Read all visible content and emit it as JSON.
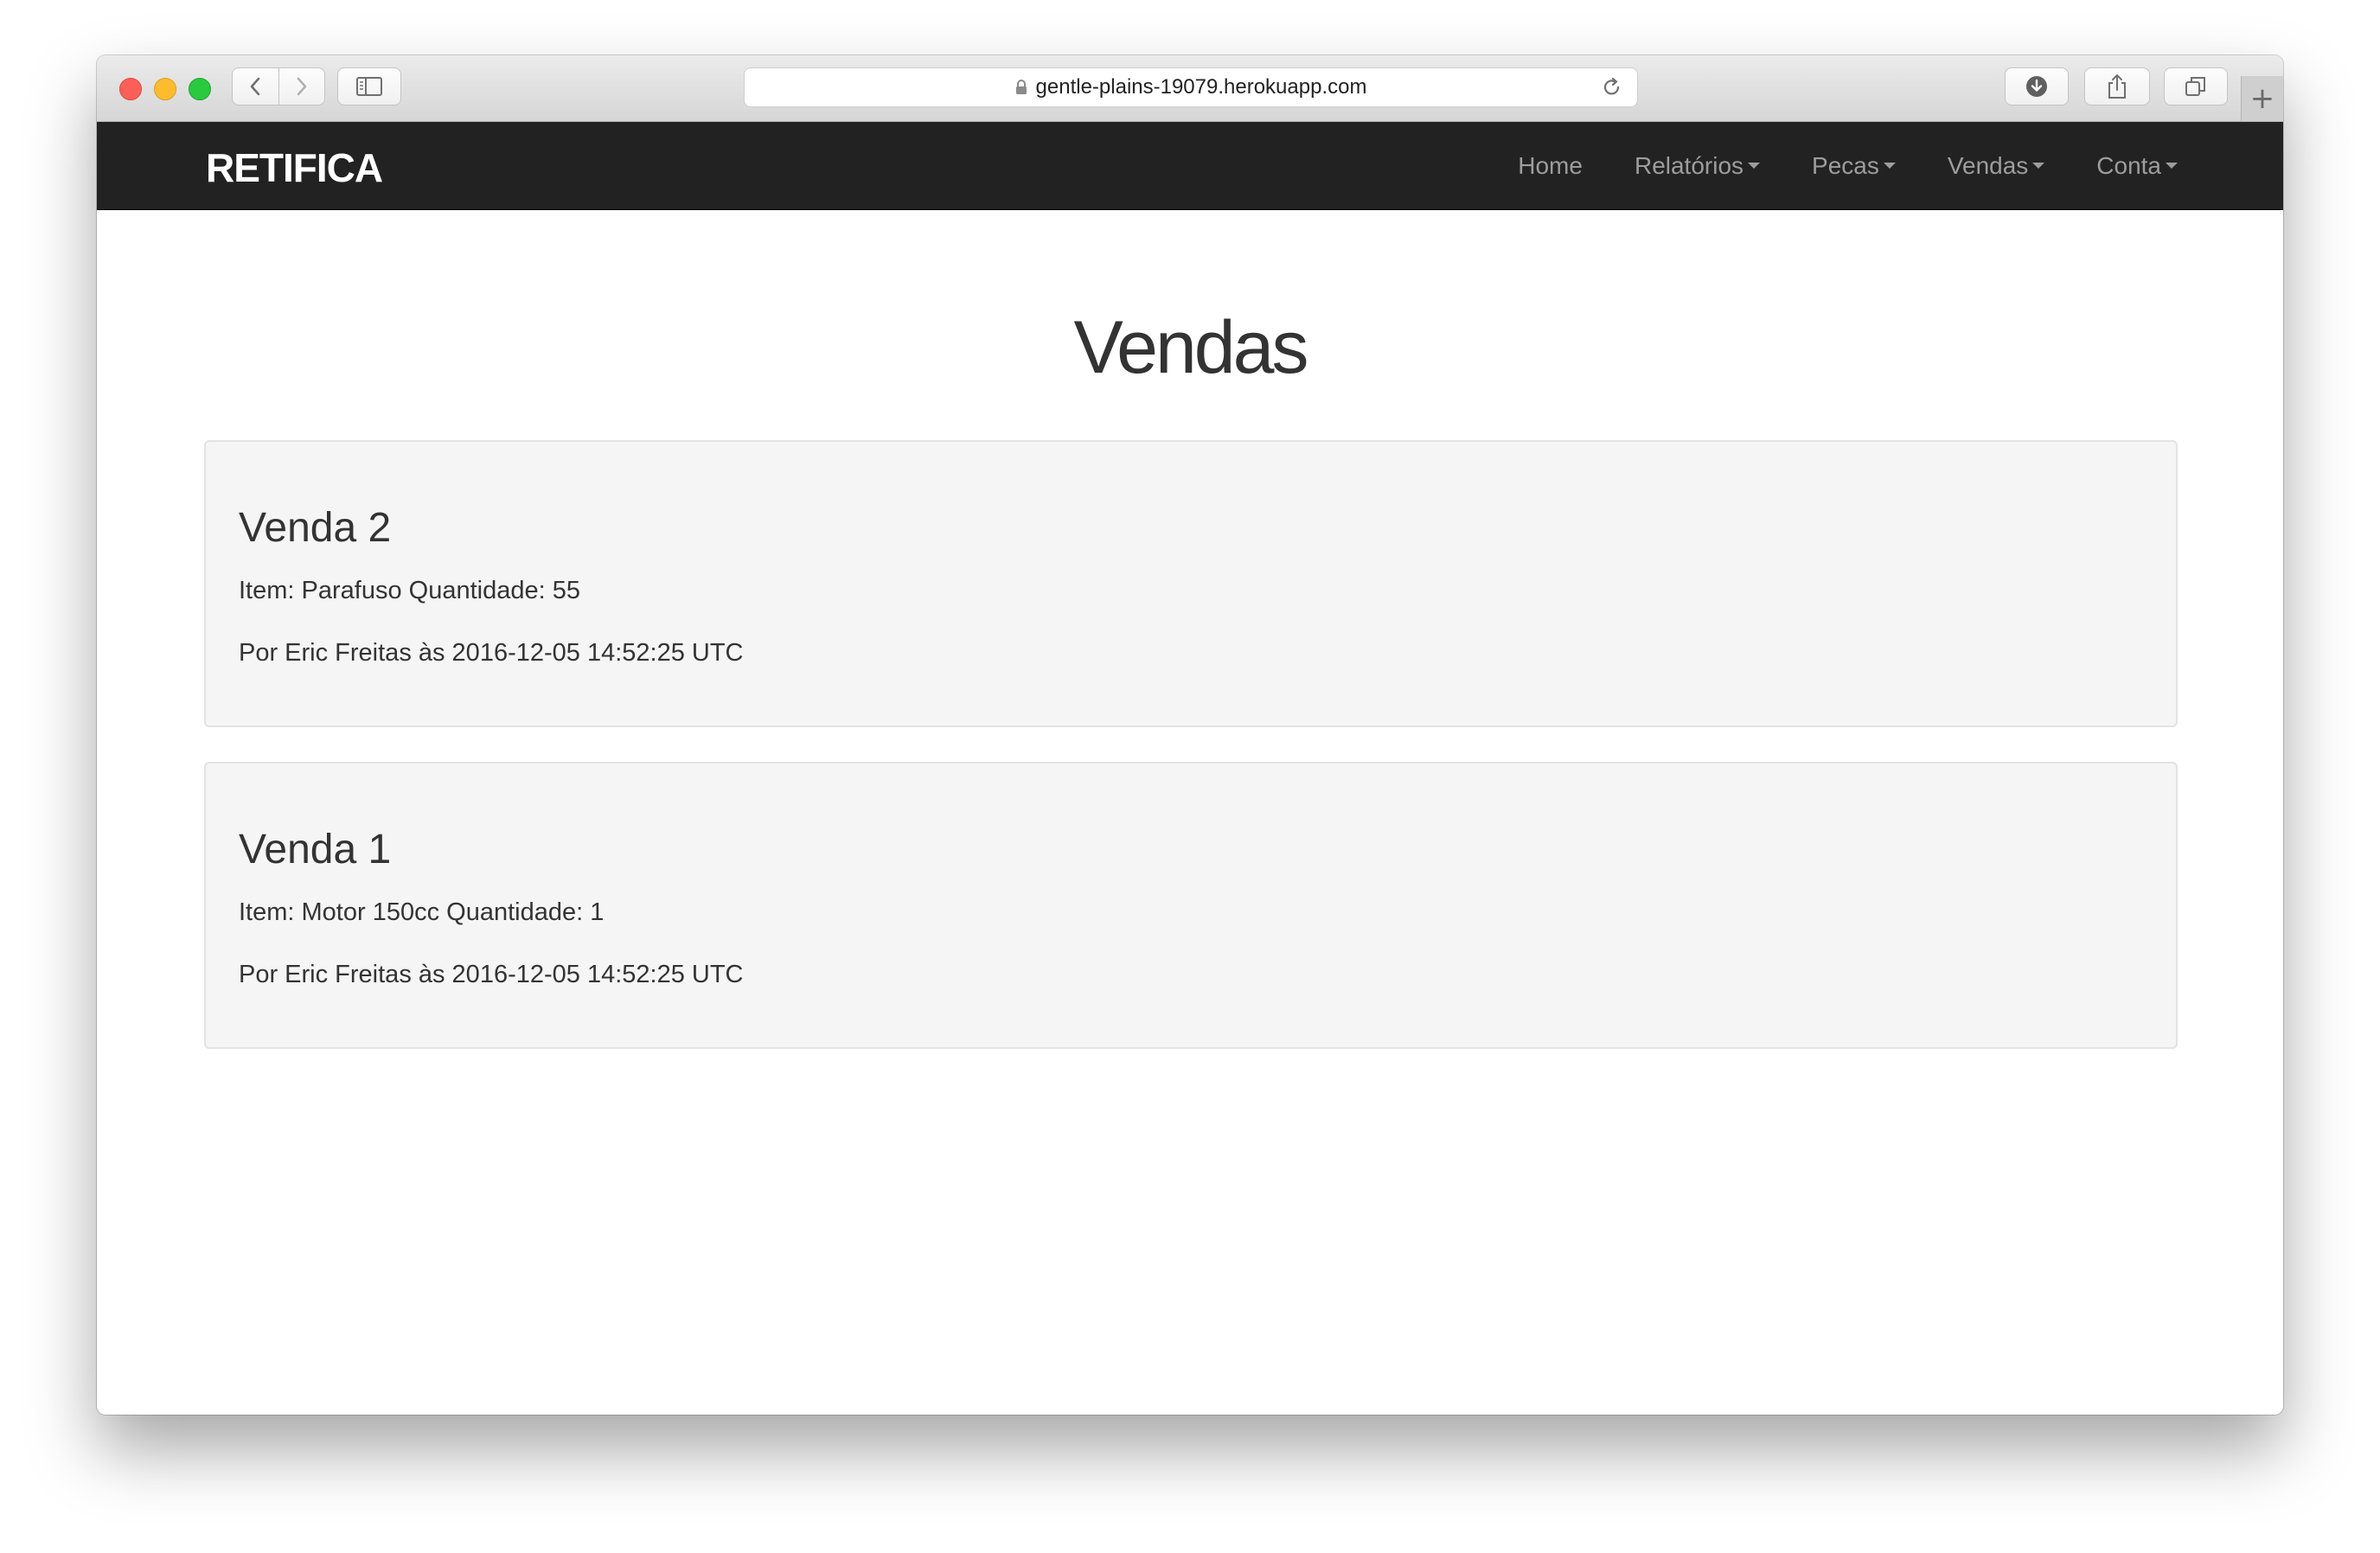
{
  "browser": {
    "url": "gentle-plains-19079.herokuapp.com",
    "new_tab_symbol": "+"
  },
  "navbar": {
    "brand": "RETIFICA",
    "items": [
      {
        "label": "Home",
        "dropdown": false
      },
      {
        "label": "Relatórios",
        "dropdown": true
      },
      {
        "label": "Pecas",
        "dropdown": true
      },
      {
        "label": "Vendas",
        "dropdown": true
      },
      {
        "label": "Conta",
        "dropdown": true
      }
    ]
  },
  "page": {
    "title": "Vendas"
  },
  "sales": [
    {
      "title": "Venda 2",
      "item_line": "Item: Parafuso Quantidade: 55",
      "by_line": "Por Eric Freitas às 2016-12-05 14:52:25 UTC"
    },
    {
      "title": "Venda 1",
      "item_line": "Item: Motor 150cc Quantidade: 1",
      "by_line": "Por Eric Freitas às 2016-12-05 14:52:25 UTC"
    }
  ],
  "colors": {
    "navbar_bg": "#222222",
    "navbar_link": "#9d9d9d",
    "card_bg": "#f5f5f5",
    "text": "#333333"
  }
}
